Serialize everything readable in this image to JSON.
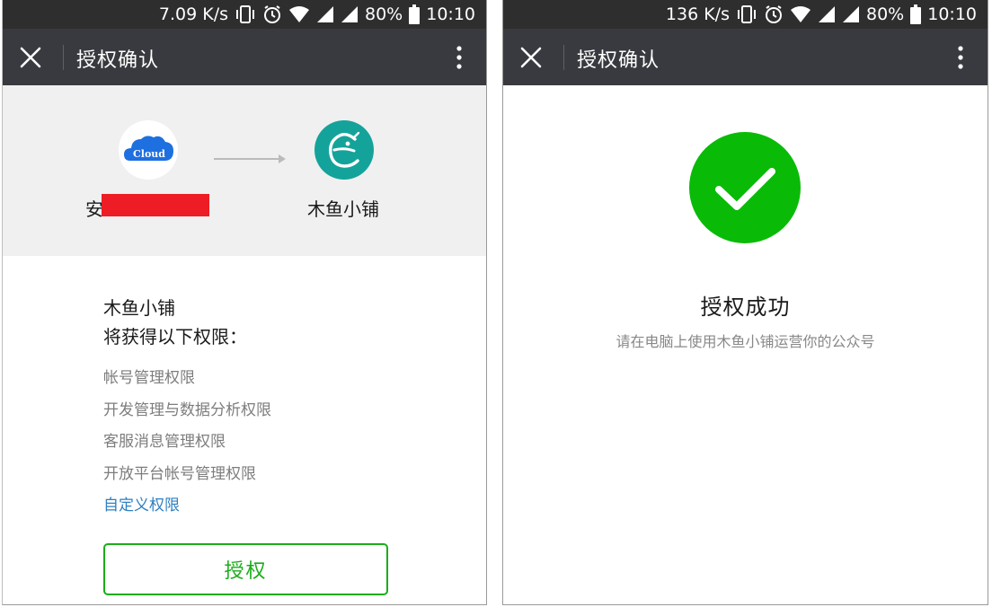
{
  "left": {
    "status": {
      "speed": "7.09 K/s",
      "battery": "80%",
      "time": "10:10"
    },
    "appbar": {
      "title": "授权确认"
    },
    "source_app": {
      "name_visible": "安",
      "logo_text": "Cloud"
    },
    "target_app": {
      "name": "木鱼小铺"
    },
    "permissions": {
      "app_name": "木鱼小铺",
      "heading": "将获得以下权限：",
      "items": [
        "帐号管理权限",
        "开发管理与数据分析权限",
        "客服消息管理权限",
        "开放平台帐号管理权限"
      ],
      "custom_link": "自定义权限"
    },
    "authorize_button": "授权"
  },
  "right": {
    "status": {
      "speed": "136 K/s",
      "battery": "80%",
      "time": "10:10"
    },
    "appbar": {
      "title": "授权确认"
    },
    "success": {
      "title": "授权成功",
      "description": "请在电脑上使用木鱼小铺运营你的公众号"
    }
  },
  "icons": {
    "close": "close-icon",
    "more": "more-vertical-icon",
    "arrow": "arrow-right-icon",
    "success": "check-circle-icon"
  },
  "colors": {
    "appbar": "#393a3f",
    "statusbar": "#2e2e2e",
    "accent_green": "#1aad19",
    "link_blue": "#2e80c2",
    "redaction": "#ee1c24"
  }
}
